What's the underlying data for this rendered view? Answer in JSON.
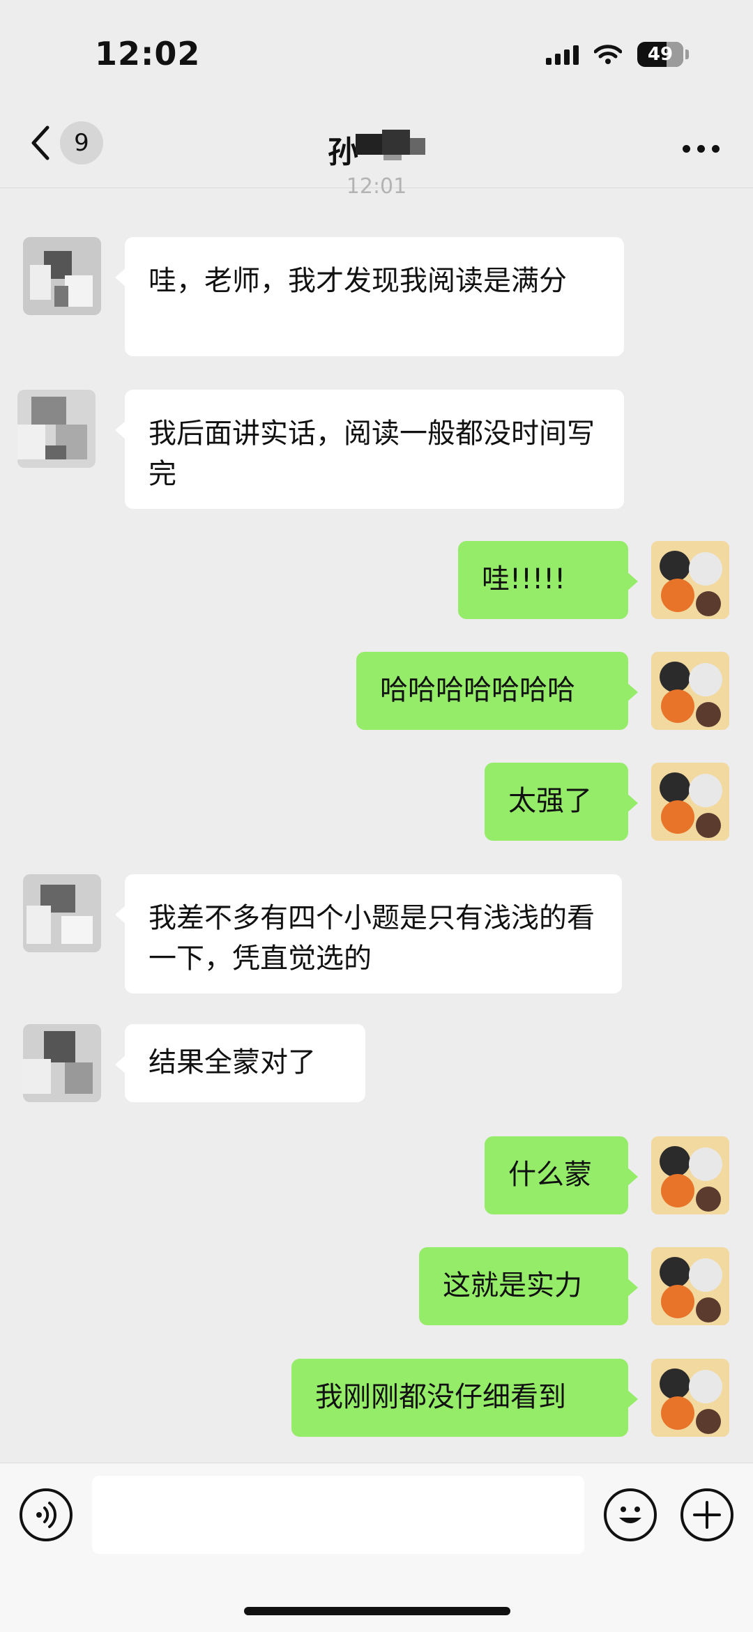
{
  "status_bar": {
    "time": "12:02",
    "battery": "49"
  },
  "nav": {
    "back_count": "9",
    "title": "孙"
  },
  "timestamp": "12:01",
  "messages": [
    {
      "from": "other",
      "text": "哇，老师，我才发现我阅读是满分"
    },
    {
      "from": "other",
      "text": "我后面讲实话，阅读一般都没时间写完"
    },
    {
      "from": "me",
      "text": "哇!!!!!"
    },
    {
      "from": "me",
      "text": "哈哈哈哈哈哈哈"
    },
    {
      "from": "me",
      "text": "太强了"
    },
    {
      "from": "other",
      "text": "我差不多有四个小题是只有浅浅的看一下，凭直觉选的"
    },
    {
      "from": "other",
      "text": "结果全蒙对了"
    },
    {
      "from": "me",
      "text": "什么蒙"
    },
    {
      "from": "me",
      "text": "这就是实力"
    },
    {
      "from": "me",
      "text": "我刚刚都没仔细看到"
    }
  ],
  "input": {
    "value": "",
    "placeholder": ""
  },
  "colors": {
    "background": "#ededed",
    "my_bubble": "#95ec69",
    "their_bubble": "#ffffff"
  },
  "icons": {
    "back": "chevron-left-icon",
    "more": "ellipsis-icon",
    "voice": "voice-icon",
    "emoji": "emoji-icon",
    "plus": "plus-icon"
  }
}
